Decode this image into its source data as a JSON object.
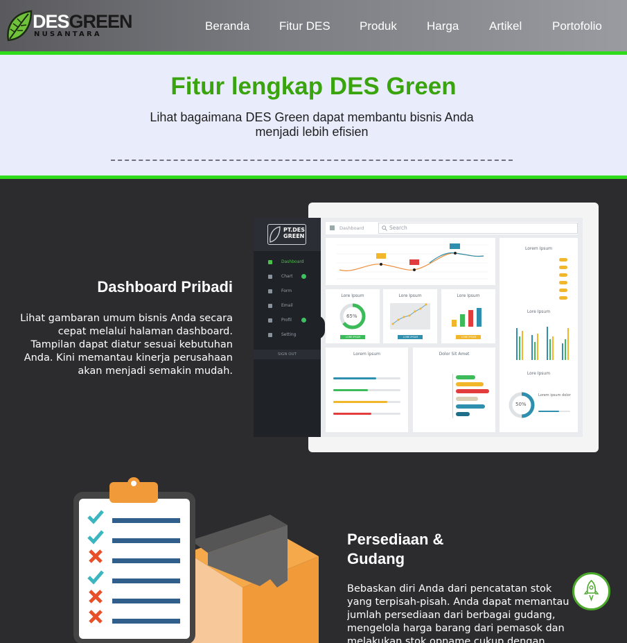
{
  "header": {
    "logo_main_1": "DES",
    "logo_main_2": "GREEN",
    "logo_sub": "NUSANTARA",
    "nav": [
      "Beranda",
      "Fitur DES",
      "Produk",
      "Harga",
      "Artikel",
      "Portofolio"
    ]
  },
  "hero": {
    "title": "Fitur lengkap DES Green",
    "subtitle": "Lihat bagaimana DES Green dapat membantu bisnis Anda menjadi lebih efisien"
  },
  "features": [
    {
      "title": "Dashboard Pribadi",
      "text": "Lihat gambaran umum bisnis Anda secara cepat melalui halaman dashboard. Tampilan dapat diatur sesuai kebutuhan Anda. Kini memantau kinerja perusahaan akan menjadi semakin mudah."
    },
    {
      "title_line1": "Persediaan &",
      "title_line2": "Gudang",
      "text": "Bebaskan diri Anda dari pencatatan stok yang terpisah-pisah. Anda dapat memantau jumlah persediaan dari berbagai gudang, mengelola harga barang dari pemasok dan melakukan stok opname cukup dengan"
    }
  ],
  "dashboard_mockup": {
    "brand_1": "PT.DES",
    "brand_2": "GREEN",
    "menu": [
      "Dashboard",
      "Chart",
      "Form",
      "Email",
      "Profil",
      "Setting"
    ],
    "signout": "SIGN OUT",
    "breadcrumb": "Dashboard",
    "search_placeholder": "Search",
    "card_titles": [
      "Lore Ipsum",
      "Lore Ipsum",
      "Lore Ipsum",
      "Lorem ipsum",
      "Dolor Sit Amet",
      "Lorem Ipsum",
      "Lore Ipsum",
      "Lore Ipsum"
    ],
    "donut_1": "65%",
    "donut_2": "50%",
    "card_buttons": [
      "LORE IPSUM",
      "LORE IPSUM",
      "LORE IPSUM"
    ],
    "side_text": "Lorem ipsum dolor"
  },
  "colors": {
    "accent_green": "#2fdc1c",
    "title_green": "#3aa40e",
    "hero_bg": "#e9ecfb",
    "section_bg": "#2c2c2e"
  },
  "icons": [
    "leaf-logo-icon",
    "search-icon",
    "home-icon",
    "rocket-icon",
    "clipboard-illustration",
    "box-illustration"
  ]
}
